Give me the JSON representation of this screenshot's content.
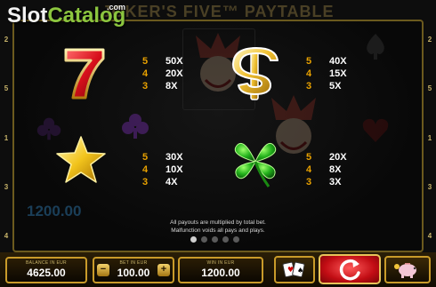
{
  "game": {
    "title": "JOKER'S FIVE™ PAYTABLE",
    "watermark_main": "Slot",
    "watermark_accent": "Catalog",
    "watermark_suffix": ".com"
  },
  "side_numbers_left": [
    "2",
    "5",
    "1",
    "3",
    "4"
  ],
  "side_numbers_right": [
    "2",
    "5",
    "1",
    "3",
    "4"
  ],
  "ghost_win_text": "1200.00",
  "paytable": [
    {
      "symbol": "seven-icon",
      "rows": [
        {
          "count": "5",
          "mult": "50X"
        },
        {
          "count": "4",
          "mult": "20X"
        },
        {
          "count": "3",
          "mult": "8X"
        }
      ]
    },
    {
      "symbol": "dollar-icon",
      "rows": [
        {
          "count": "5",
          "mult": "40X"
        },
        {
          "count": "4",
          "mult": "15X"
        },
        {
          "count": "3",
          "mult": "5X"
        }
      ]
    },
    {
      "symbol": "star-icon",
      "rows": [
        {
          "count": "5",
          "mult": "30X"
        },
        {
          "count": "4",
          "mult": "10X"
        },
        {
          "count": "3",
          "mult": "4X"
        }
      ]
    },
    {
      "symbol": "clover-icon",
      "rows": [
        {
          "count": "5",
          "mult": "20X"
        },
        {
          "count": "4",
          "mult": "8X"
        },
        {
          "count": "3",
          "mult": "3X"
        }
      ]
    }
  ],
  "note_line1": "All payouts are multiplied by total bet.",
  "note_line2": "Malfunction voids all pays and plays.",
  "pagination": {
    "pages": 5,
    "active_index": 0
  },
  "meters": {
    "balance_label": "BALANCE IN EUR",
    "balance_value": "4625.00",
    "bet_label": "BET IN EUR",
    "bet_value": "100.00",
    "win_label": "WIN IN EUR",
    "win_value": "1200.00"
  },
  "buttons": {
    "bet_minus": "−",
    "bet_plus": "+"
  },
  "colors": {
    "count_orange": "#e8a100",
    "gold_border": "#c99b2a",
    "spin_red": "#c20d14"
  }
}
